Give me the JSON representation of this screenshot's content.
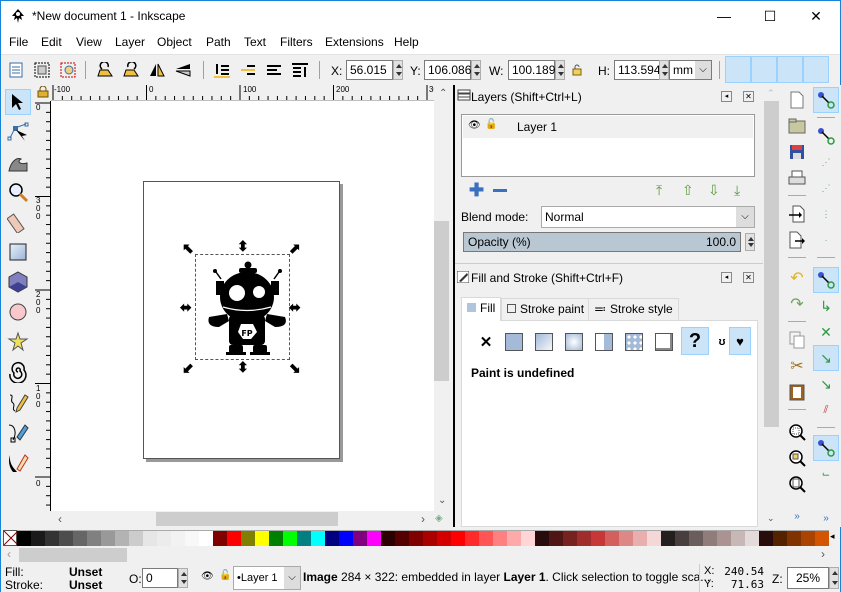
{
  "window": {
    "title": "*New document 1 - Inkscape",
    "minimize": "—",
    "maximize": "☐",
    "close": "✕"
  },
  "menu": [
    "File",
    "Edit",
    "View",
    "Layer",
    "Object",
    "Path",
    "Text",
    "Filters",
    "Extensions",
    "Help"
  ],
  "toolbar": {
    "x_label": "X:",
    "x_value": "56.015",
    "y_label": "Y:",
    "y_value": "106.086",
    "w_label": "W:",
    "w_value": "100.189",
    "h_label": "H:",
    "h_value": "113.594",
    "unit": "mm"
  },
  "rulers": {
    "horizontal": [
      "-100",
      "0",
      "100",
      "200",
      "30"
    ],
    "vertical": [
      "0",
      "300",
      "200",
      "100",
      "0"
    ]
  },
  "tools": [
    "selector",
    "node",
    "tweak",
    "zoom",
    "measure",
    "rectangle",
    "3d-box",
    "ellipse",
    "star",
    "spiral",
    "pencil",
    "pen",
    "calligraphy"
  ],
  "layers_panel": {
    "title": "Layers (Shift+Ctrl+L)",
    "layers": [
      {
        "name": "Layer 1"
      }
    ],
    "blend_label": "Blend mode:",
    "blend_value": "Normal",
    "opacity_label": "Opacity (%)",
    "opacity_value": "100.0"
  },
  "fill_stroke_panel": {
    "title": "Fill and Stroke (Shift+Ctrl+F)",
    "tabs": [
      "Fill",
      "Stroke paint",
      "Stroke style"
    ],
    "active_tab": "Fill",
    "paint_status": "Paint is undefined",
    "paint_buttons": [
      "none",
      "flat",
      "linear",
      "radial",
      "pattern",
      "swatch",
      "mesh",
      "unset"
    ]
  },
  "palette": [
    "#000000",
    "#1a1a1a",
    "#333333",
    "#4d4d4d",
    "#666666",
    "#808080",
    "#999999",
    "#b3b3b3",
    "#cccccc",
    "#e6e6e6",
    "#ececec",
    "#f2f2f2",
    "#f8f8f8",
    "#ffffff",
    "#800000",
    "#ff0000",
    "#808000",
    "#ffff00",
    "#008000",
    "#00ff00",
    "#008080",
    "#00ffff",
    "#000080",
    "#0000ff",
    "#800080",
    "#ff00ff",
    "#2b0000",
    "#550000",
    "#800000",
    "#aa0000",
    "#d40000",
    "#ff0000",
    "#ff2a2a",
    "#ff5555",
    "#ff8080",
    "#ffaaaa",
    "#ffd5d5",
    "#280b0b",
    "#501616",
    "#782121",
    "#a02c2c",
    "#c83737",
    "#d35f5f",
    "#de8787",
    "#e9afaf",
    "#f4d7d7",
    "#241f1f",
    "#483e3e",
    "#6c5d5d",
    "#917c7c",
    "#ac9393",
    "#c8b7b7",
    "#e3dbdb",
    "#280b0b",
    "#552200",
    "#803300",
    "#aa4400",
    "#d45500"
  ],
  "status": {
    "fill_label": "Fill:",
    "fill_value": "Unset",
    "stroke_label": "Stroke:",
    "stroke_value": "Unset",
    "opacity_label": "O:",
    "opacity_value": "0",
    "layer": "•Layer 1",
    "message_bold": "Image",
    "message": " 284 × 322: embedded in layer ",
    "message_layer": "Layer 1",
    "message_tail": ". Click selection to toggle sca...",
    "cursor_x_label": "X:",
    "cursor_x": "240.54",
    "cursor_y_label": "Y:",
    "cursor_y": "71.63",
    "zoom_label": "Z:",
    "zoom_value": "25%"
  }
}
